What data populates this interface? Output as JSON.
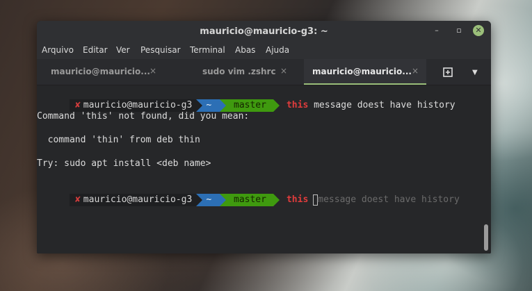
{
  "window": {
    "title": "mauricio@mauricio-g3: ~",
    "controls": {
      "minimize": "–",
      "maximize": "▫",
      "close": "✕"
    }
  },
  "menu": {
    "items": [
      "Arquivo",
      "Editar",
      "Ver",
      "Pesquisar",
      "Terminal",
      "Abas",
      "Ajuda"
    ]
  },
  "tabs": [
    {
      "label": "mauricio@mauricio...",
      "close": "×",
      "active": false
    },
    {
      "label": "sudo vim .zshrc",
      "close": "×",
      "active": false
    },
    {
      "label": "mauricio@mauricio...",
      "close": "×",
      "active": true
    }
  ],
  "tabbar": {
    "dropdown": "▼"
  },
  "terminal": {
    "prompt": {
      "error_mark": "✘",
      "user_host": "mauricio@mauricio-g3",
      "dir": "~",
      "git_branch": " master"
    },
    "line1": {
      "cmd": "this",
      "args": " message doest have history"
    },
    "output": [
      "Command 'this' not found, did you mean:",
      "  command 'thin' from deb thin",
      "Try: sudo apt install <deb name>"
    ],
    "line2": {
      "cmd": "this",
      "ghost": "message doest have history"
    }
  },
  "colors": {
    "accent": "#9bbf7a",
    "prompt_dir": "#2c6fb5",
    "prompt_git": "#3f9a0f",
    "command_error": "#e03c3c"
  }
}
